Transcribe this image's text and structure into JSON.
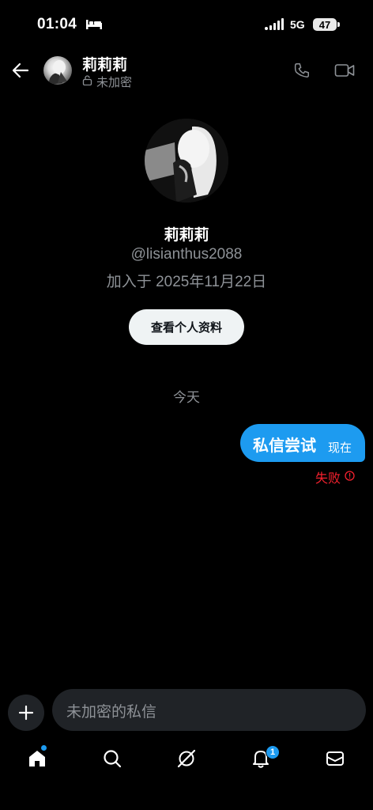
{
  "status_bar": {
    "time": "01:04",
    "network": "5G",
    "battery": "47"
  },
  "header": {
    "name": "莉莉莉",
    "encryption": "未加密"
  },
  "profile": {
    "name": "莉莉莉",
    "handle": "@lisianthus2088",
    "joined": "加入于 2025年11月22日",
    "view_profile_label": "查看个人资料"
  },
  "conversation": {
    "date_separator": "今天",
    "messages": [
      {
        "text": "私信尝试",
        "time": "现在",
        "status": "失败"
      }
    ]
  },
  "composer": {
    "placeholder": "未加密的私信"
  },
  "bottom_nav": {
    "items": [
      {
        "icon": "home-icon",
        "active": true
      },
      {
        "icon": "search-icon"
      },
      {
        "icon": "grok-icon"
      },
      {
        "icon": "notifications-icon",
        "badge": "1"
      },
      {
        "icon": "messages-icon"
      }
    ]
  },
  "colors": {
    "accent": "#1d9bf0",
    "error": "#f4212e",
    "muted": "#8e9297",
    "background": "#000000"
  }
}
